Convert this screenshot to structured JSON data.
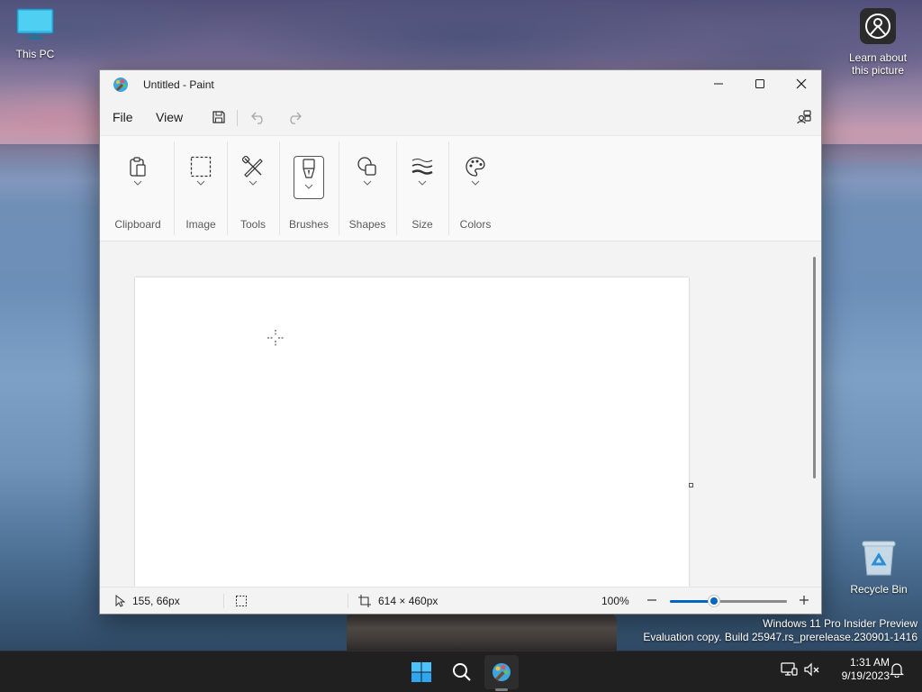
{
  "desktop": {
    "icons": [
      {
        "label": "This PC",
        "icon": "monitor-icon"
      },
      {
        "label": "Learn about this picture",
        "icon": "camera-circle-icon"
      },
      {
        "label": "Recycle Bin",
        "icon": "recycle-bin-icon"
      }
    ],
    "watermark": {
      "line1": "Windows 11 Pro Insider Preview",
      "line2": "Evaluation copy. Build 25947.rs_prerelease.230901-1416"
    }
  },
  "window": {
    "title": "Untitled - Paint",
    "app_icon": "paint-palette-icon",
    "caption_buttons": [
      "minimize-icon",
      "maximize-icon",
      "close-icon"
    ]
  },
  "menubar": {
    "file": "File",
    "view": "View",
    "quick_actions": [
      "save-icon",
      "undo-icon",
      "redo-icon"
    ],
    "share_icon": "share-icon"
  },
  "ribbon": {
    "groups": [
      {
        "label": "Clipboard",
        "icon": "clipboard-icon"
      },
      {
        "label": "Image",
        "icon": "selection-icon"
      },
      {
        "label": "Tools",
        "icon": "tools-icon"
      },
      {
        "label": "Brushes",
        "icon": "brush-icon",
        "selected": true
      },
      {
        "label": "Shapes",
        "icon": "shapes-icon"
      },
      {
        "label": "Size",
        "icon": "line-size-icon"
      },
      {
        "label": "Colors",
        "icon": "palette-icon"
      }
    ]
  },
  "statusbar": {
    "cursor_position": "155, 66px",
    "canvas_size": "614 × 460px",
    "zoom": "100%",
    "zoom_slider_fraction": 0.38
  },
  "taskbar": {
    "buttons": [
      "start-icon",
      "search-icon",
      "paint-app-icon"
    ],
    "time": "1:31 AM",
    "date": "9/19/2023"
  },
  "colors": {
    "accent": "#0067c0",
    "taskbar": "#202020",
    "window_bg": "#f3f3f3",
    "ribbon_bg": "#f9f9f9",
    "canvas": "#ffffff"
  }
}
